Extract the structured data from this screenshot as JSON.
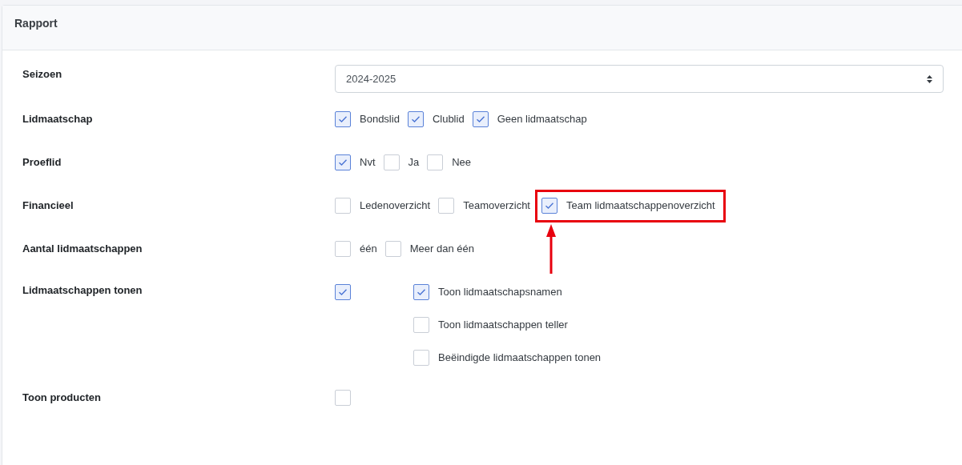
{
  "card": {
    "title": "Rapport"
  },
  "rows": [
    {
      "kind": "select",
      "label": "Seizoen",
      "value": "2024-2025"
    },
    {
      "kind": "checkboxes",
      "label": "Lidmaatschap",
      "options": [
        {
          "label": "Bondslid",
          "checked": true
        },
        {
          "label": "Clublid",
          "checked": true
        },
        {
          "label": "Geen lidmaatschap",
          "checked": true
        }
      ]
    },
    {
      "kind": "checkboxes",
      "label": "Proeflid",
      "options": [
        {
          "label": "Nvt",
          "checked": true
        },
        {
          "label": "Ja",
          "checked": false
        },
        {
          "label": "Nee",
          "checked": false
        }
      ]
    },
    {
      "kind": "checkboxes",
      "label": "Financieel",
      "options": [
        {
          "label": "Ledenoverzicht",
          "checked": false
        },
        {
          "label": "Teamoverzicht",
          "checked": false
        },
        {
          "label": "Team lidmaatschappenoverzicht",
          "checked": true,
          "highlighted": true
        }
      ]
    },
    {
      "kind": "checkboxes",
      "label": "Aantal lidmaatschappen",
      "options": [
        {
          "label": "één",
          "checked": false
        },
        {
          "label": "Meer dan één",
          "checked": false
        }
      ]
    },
    {
      "kind": "nested",
      "label": "Lidmaatschappen tonen",
      "checked": true,
      "children": [
        {
          "label": "Toon lidmaatschapsnamen",
          "checked": true
        },
        {
          "label": "Toon lidmaatschappen teller",
          "checked": false
        },
        {
          "label": "Beëindigde lidmaatschappen tonen",
          "checked": false
        }
      ]
    },
    {
      "kind": "single",
      "label": "Toon producten",
      "checked": false
    }
  ]
}
